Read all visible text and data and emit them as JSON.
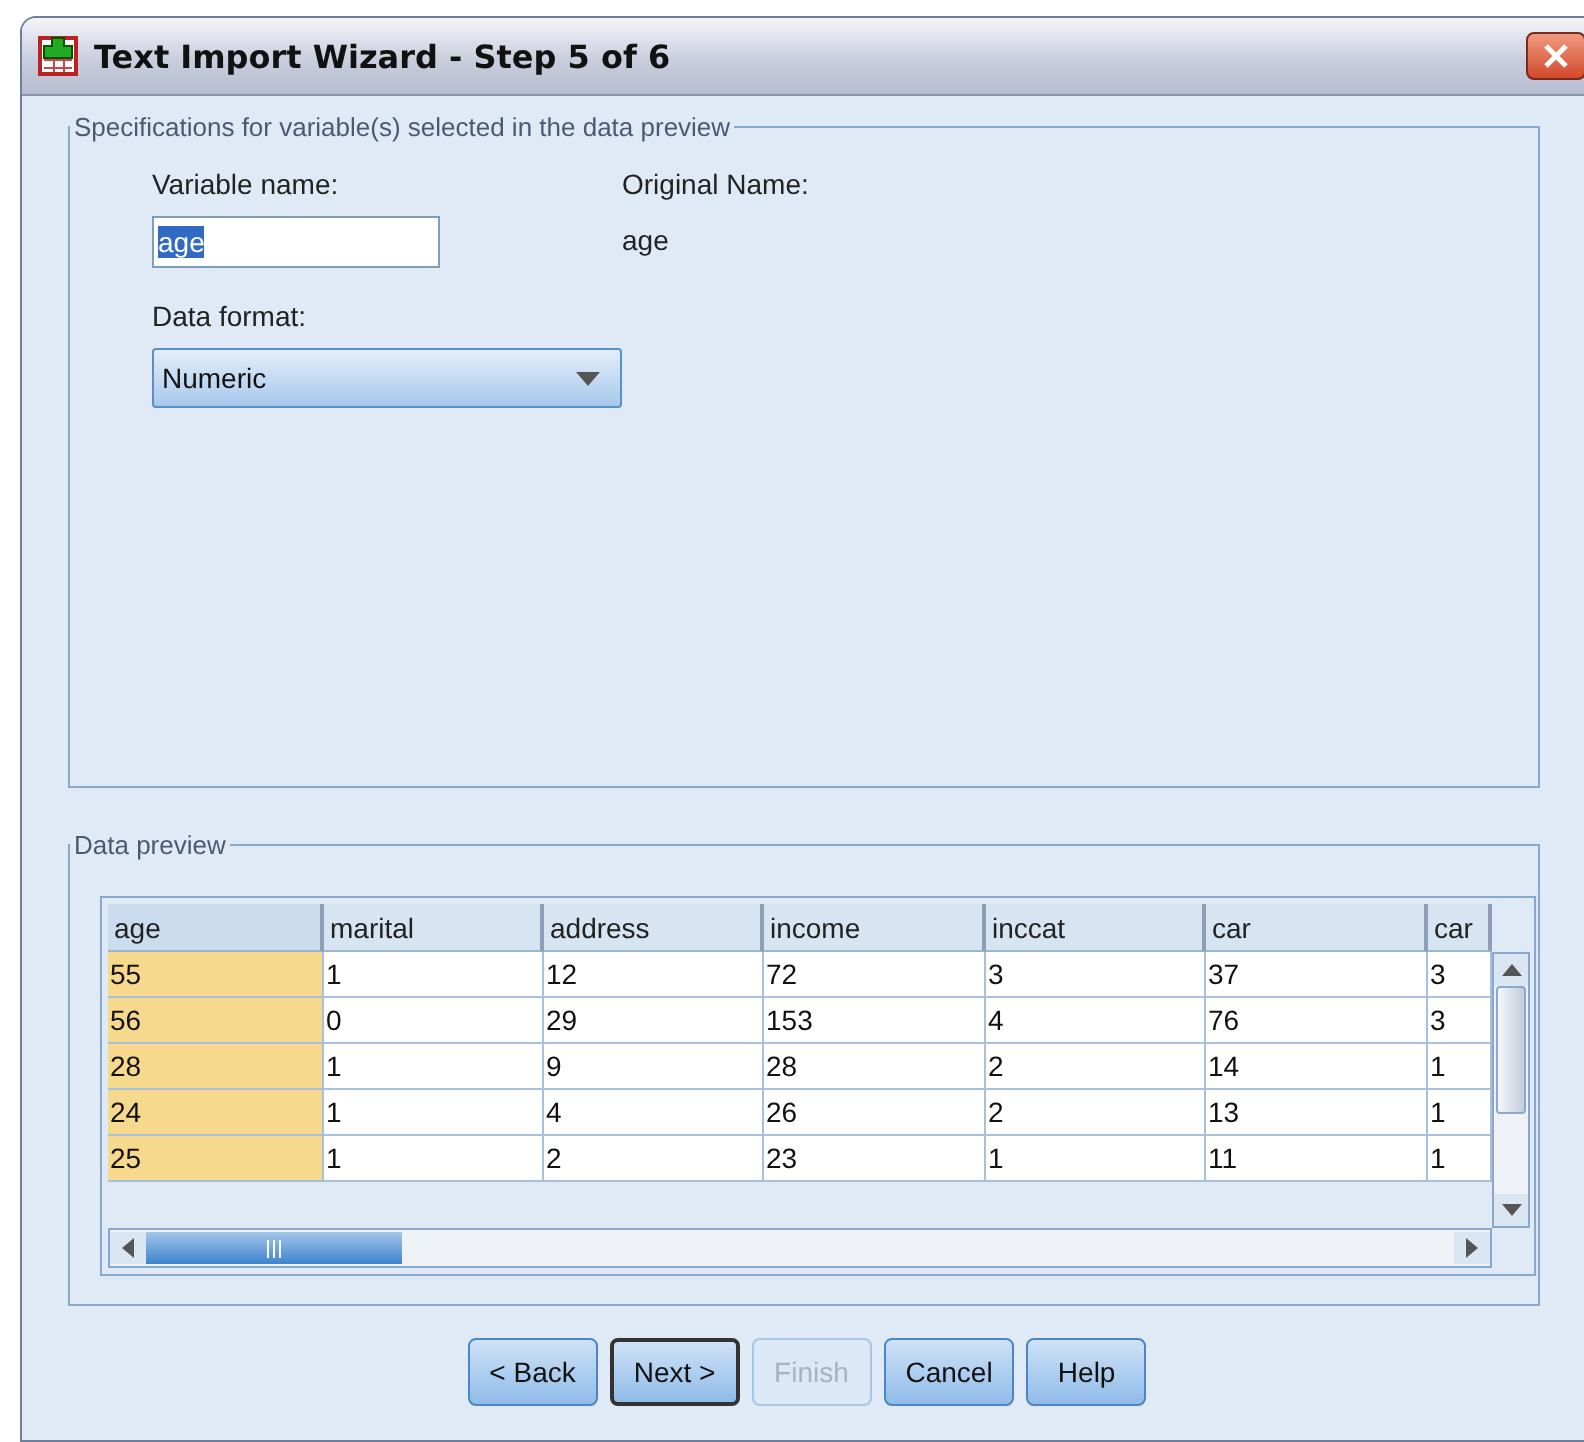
{
  "window": {
    "title": "Text Import Wizard - Step 5 of 6"
  },
  "specifications": {
    "legend": "Specifications for variable(s) selected in the data preview",
    "variable_name": {
      "label": "Variable name:",
      "value": "age"
    },
    "original_name": {
      "label": "Original Name:",
      "value": "age"
    },
    "data_format": {
      "label": "Data format:",
      "value": "Numeric"
    }
  },
  "data_preview": {
    "legend": "Data preview",
    "columns": [
      {
        "label": "age",
        "selected": true
      },
      {
        "label": "marital",
        "selected": false
      },
      {
        "label": "address",
        "selected": false
      },
      {
        "label": "income",
        "selected": false
      },
      {
        "label": "inccat",
        "selected": false
      },
      {
        "label": "car",
        "selected": false
      },
      {
        "label": "car",
        "selected": false
      }
    ],
    "rows": [
      [
        "55",
        "1",
        "12",
        "72",
        "3",
        "37",
        "3"
      ],
      [
        "56",
        "0",
        "29",
        "153",
        "4",
        "76",
        "3"
      ],
      [
        "28",
        "1",
        "9",
        "28",
        "2",
        "14",
        "1"
      ],
      [
        "24",
        "1",
        "4",
        "26",
        "2",
        "13",
        "1"
      ],
      [
        "25",
        "1",
        "2",
        "23",
        "1",
        "11",
        "1"
      ]
    ]
  },
  "buttons": [
    {
      "label": "< Back",
      "disabled": false,
      "default": false
    },
    {
      "label": "Next >",
      "disabled": false,
      "default": true
    },
    {
      "label": "Finish",
      "disabled": true,
      "default": false
    },
    {
      "label": "Cancel",
      "disabled": false,
      "default": false
    },
    {
      "label": "Help",
      "disabled": false,
      "default": false
    }
  ]
}
